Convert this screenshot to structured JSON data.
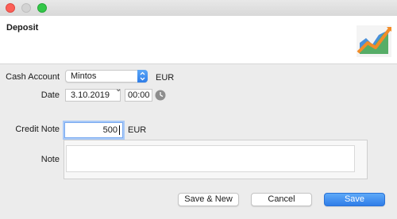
{
  "window": {
    "title": "Deposit"
  },
  "form": {
    "cash_account": {
      "label": "Cash Account",
      "value": "Mintos",
      "currency": "EUR"
    },
    "date": {
      "label": "Date",
      "value": "3.10.2019",
      "time": "00:00"
    },
    "credit_note": {
      "label": "Credit Note",
      "value": "500",
      "currency": "EUR"
    },
    "note": {
      "label": "Note",
      "value": ""
    }
  },
  "buttons": {
    "save_new": "Save & New",
    "cancel": "Cancel",
    "save": "Save"
  },
  "colors": {
    "accent": "#2f7de8",
    "focus_ring": "#a9c9f7"
  },
  "icons": {
    "logo": "trend-chart-logo-icon",
    "clock": "clock-icon",
    "stepper": "select-stepper-icon"
  }
}
